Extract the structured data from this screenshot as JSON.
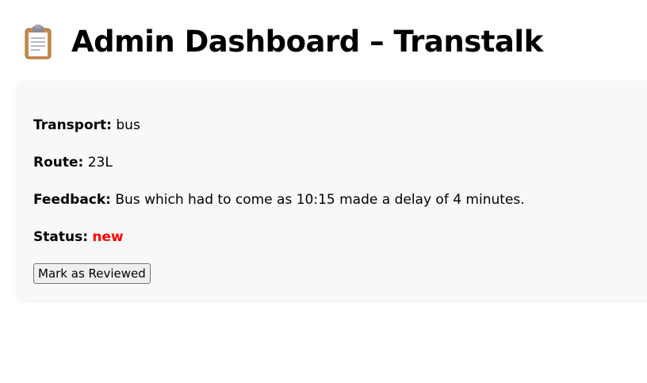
{
  "header": {
    "icon": "clipboard-icon",
    "title": "Admin Dashboard – Transtalk"
  },
  "feedback_card": {
    "transport_label": "Transport:",
    "transport_value": "bus",
    "route_label": "Route:",
    "route_value": "23L",
    "feedback_label": "Feedback:",
    "feedback_value": "Bus which had to come as 10:15 made a delay of 4 minutes.",
    "status_label": "Status:",
    "status_value": "new",
    "status_color": "#ff0000",
    "review_button_label": "Mark as Reviewed"
  }
}
